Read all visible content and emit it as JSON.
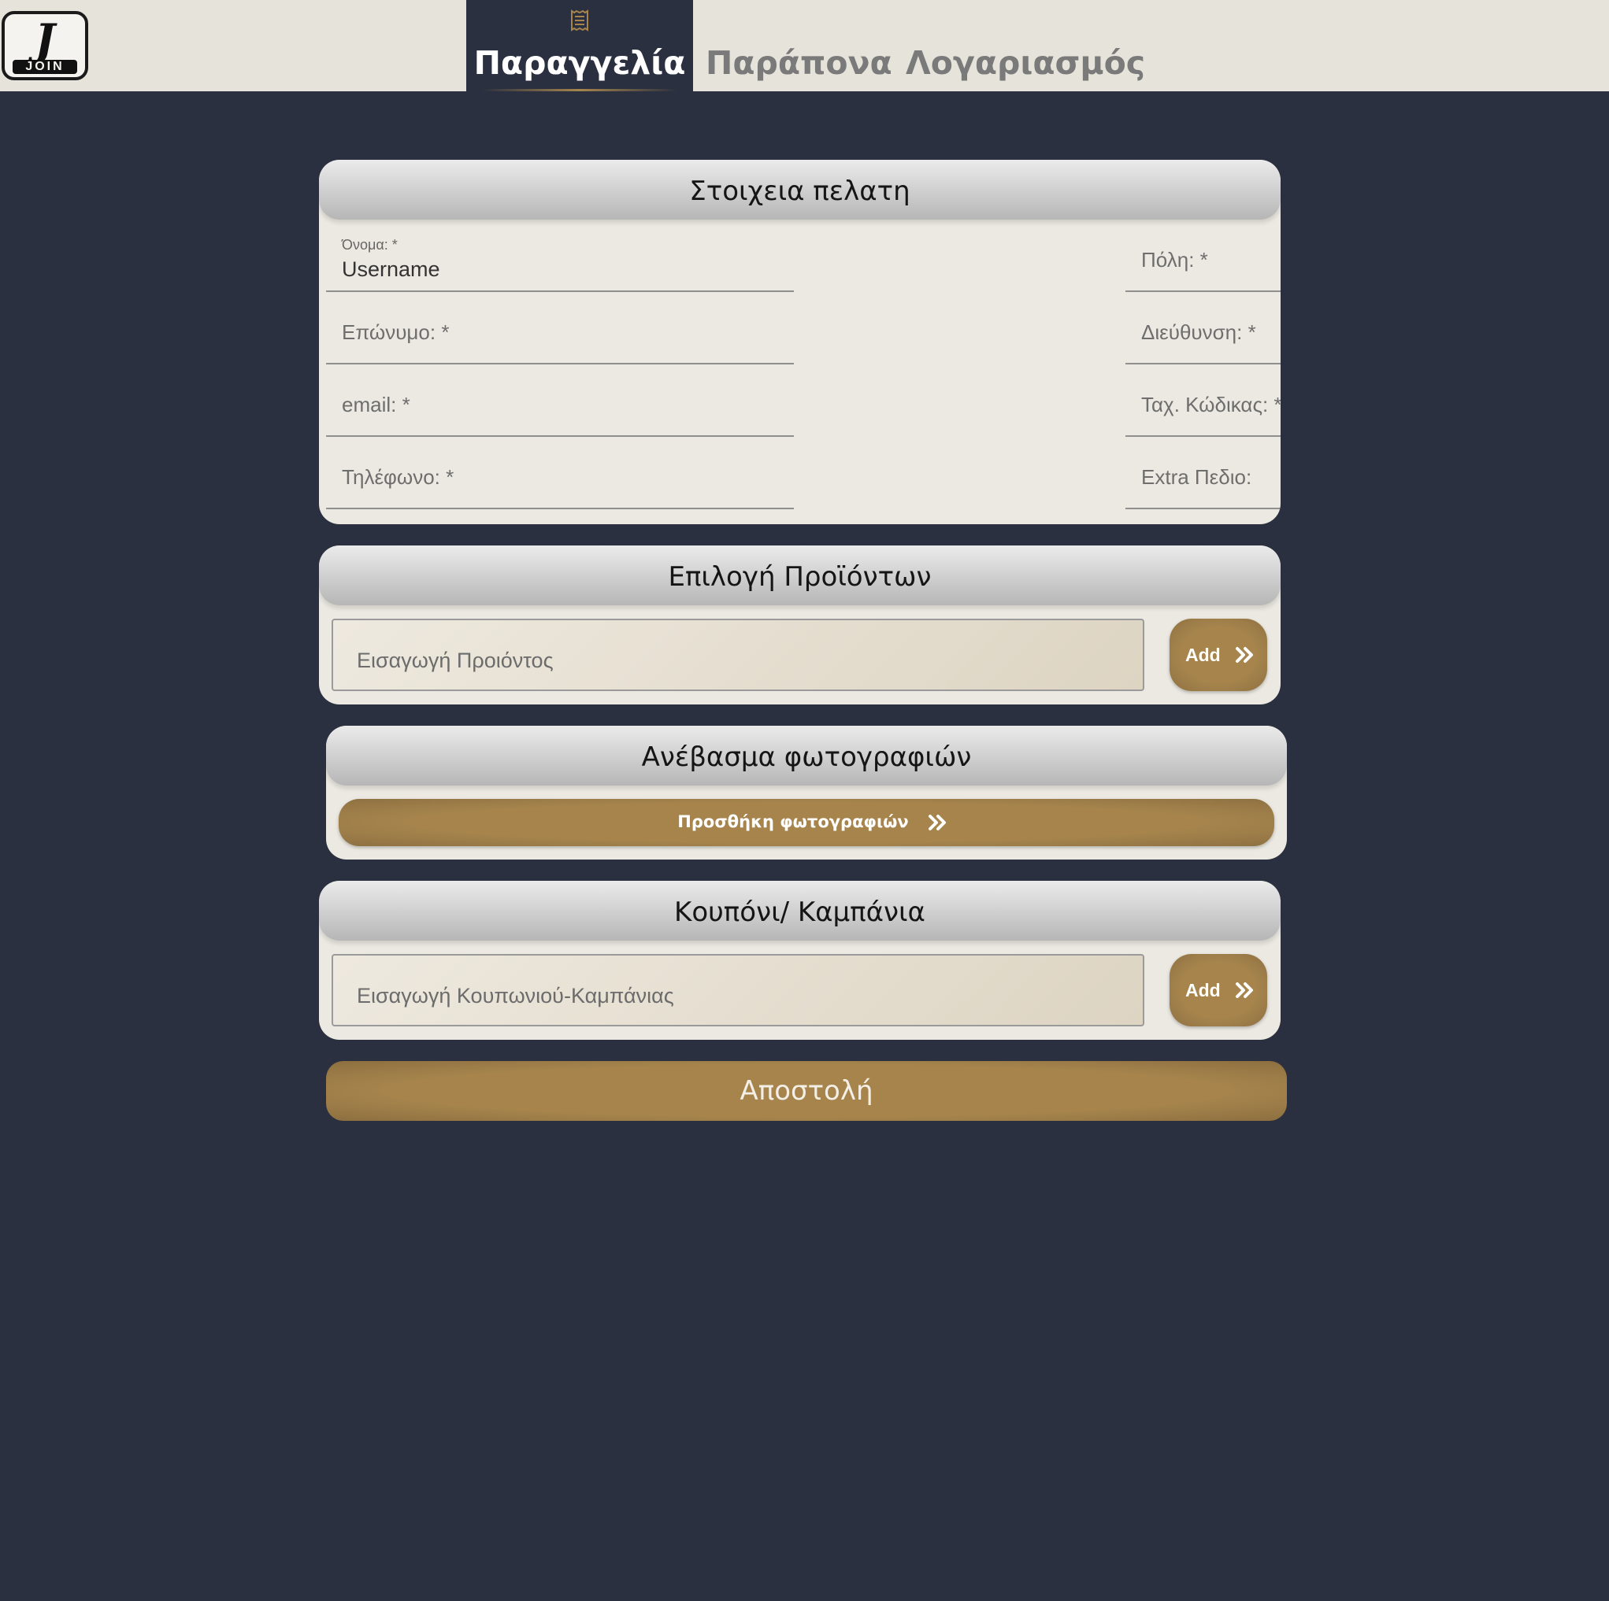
{
  "brand": {
    "logo_text": "JOIN"
  },
  "nav": {
    "tabs": [
      {
        "label": "Παραγγελία",
        "icon": "receipt-icon",
        "active": true
      },
      {
        "label": "Παράπονα",
        "active": false
      },
      {
        "label": "Λογαριασμός",
        "active": false
      }
    ]
  },
  "customer": {
    "title": "Στοιχεια πελατη",
    "name_label": "Όνομα: *",
    "name_value": "Username",
    "city_placeholder": "Πόλη: *",
    "surname_placeholder": "Επώνυμο: *",
    "address_placeholder": "Διεύθυνση: *",
    "email_placeholder": "email: *",
    "postcode_placeholder": "Ταχ. Κώδικας: *",
    "phone_placeholder": "Τηλέφωνο: *",
    "extra_placeholder": "Extra Πεδιο:"
  },
  "products": {
    "title": "Επιλογή Προϊόντων",
    "input_placeholder": "Εισαγωγή Προιόντος",
    "add_label": "Add"
  },
  "photos": {
    "title": "Ανέβασμα φωτογραφιών",
    "button_label": "Προσθήκη φωτογραφιών"
  },
  "coupon": {
    "title": "Κουπόνι/ Καμπάνια",
    "input_placeholder": "Εισαγωγή Κουπωνιού-Καμπάνιας",
    "add_label": "Add"
  },
  "submit": {
    "label": "Αποστολή"
  },
  "colors": {
    "background": "#2b3040",
    "header": "#e6e4da",
    "card": "#ebe9e1",
    "accent": "#a6844c"
  }
}
